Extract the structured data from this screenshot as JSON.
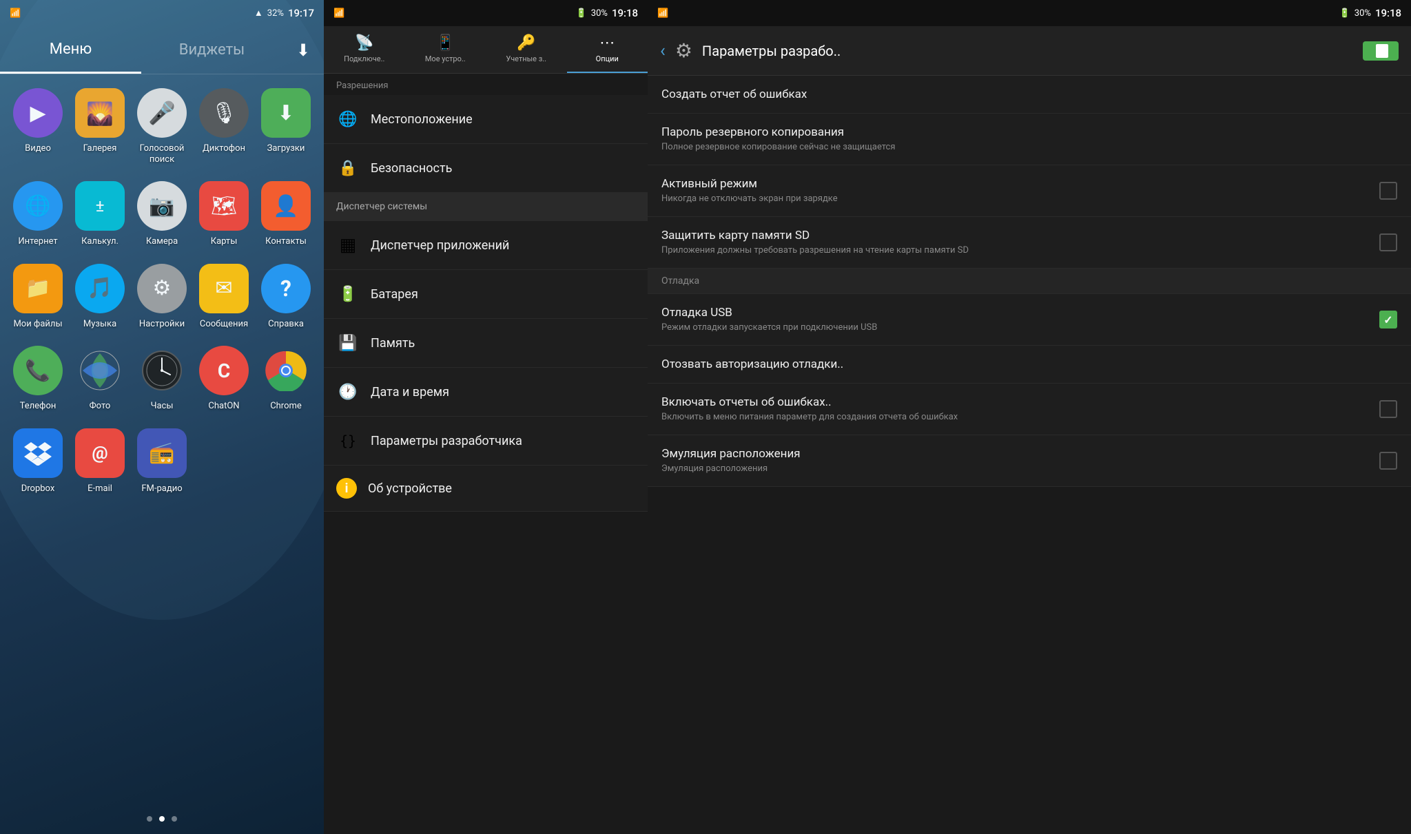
{
  "home": {
    "status_left": "📶",
    "battery": "32%",
    "time": "19:17",
    "tab_menu": "Меню",
    "tab_widgets": "Виджеты",
    "apps": [
      {
        "id": "video",
        "label": "Видео",
        "icon": "▶",
        "bg": "bg-purple",
        "shape": "circle"
      },
      {
        "id": "gallery",
        "label": "Галерея",
        "icon": "🌄",
        "bg": "bg-yellow",
        "shape": "square"
      },
      {
        "id": "voice",
        "label": "Голосовой поиск",
        "icon": "🎤",
        "bg": "bg-white",
        "shape": "circle"
      },
      {
        "id": "dictaphone",
        "label": "Диктофон",
        "icon": "🎙",
        "bg": "bg-darkgray",
        "shape": "circle"
      },
      {
        "id": "downloads",
        "label": "Загрузки",
        "icon": "⬇",
        "bg": "bg-green-dl",
        "shape": "square"
      },
      {
        "id": "internet",
        "label": "Интернет",
        "icon": "🌐",
        "bg": "bg-blue",
        "shape": "circle"
      },
      {
        "id": "calc",
        "label": "Калькул.",
        "icon": "±",
        "bg": "bg-cyan",
        "shape": "square"
      },
      {
        "id": "camera",
        "label": "Камера",
        "icon": "📷",
        "bg": "bg-white",
        "shape": "circle"
      },
      {
        "id": "maps",
        "label": "Карты",
        "icon": "🗺",
        "bg": "bg-red",
        "shape": "square"
      },
      {
        "id": "contacts",
        "label": "Контакты",
        "icon": "👤",
        "bg": "bg-orange",
        "shape": "square"
      },
      {
        "id": "myfiles",
        "label": "Мои файлы",
        "icon": "📁",
        "bg": "bg-folder",
        "shape": "square"
      },
      {
        "id": "music",
        "label": "Музыка",
        "icon": "🎵",
        "bg": "bg-lblue",
        "shape": "circle"
      },
      {
        "id": "settings",
        "label": "Настройки",
        "icon": "⚙",
        "bg": "bg-settings",
        "shape": "circle"
      },
      {
        "id": "messages",
        "label": "Сообщения",
        "icon": "✉",
        "bg": "bg-msg",
        "shape": "square"
      },
      {
        "id": "help",
        "label": "Справка",
        "icon": "?",
        "bg": "bg-help",
        "shape": "circle"
      },
      {
        "id": "phone",
        "label": "Телефон",
        "icon": "📞",
        "bg": "bg-phone",
        "shape": "circle"
      },
      {
        "id": "photos",
        "label": "Фото",
        "icon": "🌈",
        "bg": "bg-photos",
        "shape": "circle"
      },
      {
        "id": "clock",
        "label": "Часы",
        "icon": "🕐",
        "bg": "bg-clock",
        "shape": "circle"
      },
      {
        "id": "chaton",
        "label": "ChatON",
        "icon": "C",
        "bg": "bg-chaton",
        "shape": "circle"
      },
      {
        "id": "chrome",
        "label": "Chrome",
        "icon": "🔵",
        "bg": "bg-chrome",
        "shape": "circle"
      },
      {
        "id": "dropbox",
        "label": "Dropbox",
        "icon": "📦",
        "bg": "bg-dropbox",
        "shape": "square"
      },
      {
        "id": "email",
        "label": "E-mail",
        "icon": "@",
        "bg": "bg-email",
        "shape": "square"
      },
      {
        "id": "radio",
        "label": "FM-радио",
        "icon": "📻",
        "bg": "bg-radio",
        "shape": "square"
      }
    ],
    "dots": [
      false,
      true,
      false
    ]
  },
  "settings": {
    "battery": "30%",
    "time": "19:18",
    "tabs": [
      {
        "id": "connections",
        "label": "Подключе..",
        "icon": "📡",
        "active": false
      },
      {
        "id": "mydevice",
        "label": "Мое устро..",
        "icon": "📱",
        "active": false
      },
      {
        "id": "accounts",
        "label": "Учетные з..",
        "icon": "🔑",
        "active": false
      },
      {
        "id": "options",
        "label": "Опции",
        "icon": "⋯",
        "active": true
      }
    ],
    "section_permissions": "Разрешения",
    "items": [
      {
        "id": "location",
        "label": "Местоположение",
        "icon": "🌐",
        "type": "item",
        "selected": false
      },
      {
        "id": "security",
        "label": "Безопасность",
        "icon": "🔒",
        "type": "item",
        "selected": false
      },
      {
        "id": "system_manager",
        "label": "Диспетчер системы",
        "icon": "",
        "type": "section-header",
        "selected": true
      },
      {
        "id": "app_manager",
        "label": "Диспетчер приложений",
        "icon": "▦",
        "type": "item",
        "selected": false
      },
      {
        "id": "battery",
        "label": "Батарея",
        "icon": "🔋",
        "type": "item",
        "selected": false
      },
      {
        "id": "memory",
        "label": "Память",
        "icon": "💾",
        "type": "item",
        "selected": false
      },
      {
        "id": "datetime",
        "label": "Дата и время",
        "icon": "🕐",
        "type": "item",
        "selected": false
      },
      {
        "id": "developer",
        "label": "Параметры разработчика",
        "icon": "{}",
        "type": "item",
        "selected": false
      },
      {
        "id": "about",
        "label": "Об устройстве",
        "icon": "ℹ",
        "type": "item",
        "selected": false
      }
    ]
  },
  "developer": {
    "battery": "30%",
    "time": "19:18",
    "title": "Параметры разрабо..",
    "back_label": "‹",
    "items": [
      {
        "id": "bug-report",
        "title": "Создать отчет об ошибках",
        "subtitle": "",
        "checkbox": false,
        "has_checkbox": false,
        "section": false
      },
      {
        "id": "backup-password",
        "title": "Пароль резервного копирования",
        "subtitle": "Полное резервное копирование сейчас не защищается",
        "checkbox": false,
        "has_checkbox": false,
        "section": false
      },
      {
        "id": "active-mode",
        "title": "Активный режим",
        "subtitle": "Никогда не отключать экран при зарядке",
        "checkbox": false,
        "has_checkbox": true,
        "checked": false,
        "section": false
      },
      {
        "id": "protect-sd",
        "title": "Защитить карту памяти SD",
        "subtitle": "Приложения должны требовать разрешения на чтение карты памяти SD",
        "checkbox": false,
        "has_checkbox": true,
        "checked": false,
        "section": false
      },
      {
        "id": "debug-section",
        "title": "Отладка",
        "subtitle": "",
        "has_checkbox": false,
        "section": true
      },
      {
        "id": "usb-debug",
        "title": "Отладка USB",
        "subtitle": "Режим отладки запускается при подключении USB",
        "has_checkbox": true,
        "checked": true,
        "section": false
      },
      {
        "id": "revoke-auth",
        "title": "Отозвать авторизацию отладки..",
        "subtitle": "",
        "has_checkbox": false,
        "section": false
      },
      {
        "id": "bug-reports-menu",
        "title": "Включать отчеты об ошибках..",
        "subtitle": "Включить в меню питания параметр для создания отчета об ошибках",
        "has_checkbox": true,
        "checked": false,
        "section": false
      },
      {
        "id": "emulate-location",
        "title": "Эмуляция расположения",
        "subtitle": "Эмуляция расположения",
        "has_checkbox": true,
        "checked": false,
        "section": false
      }
    ]
  }
}
